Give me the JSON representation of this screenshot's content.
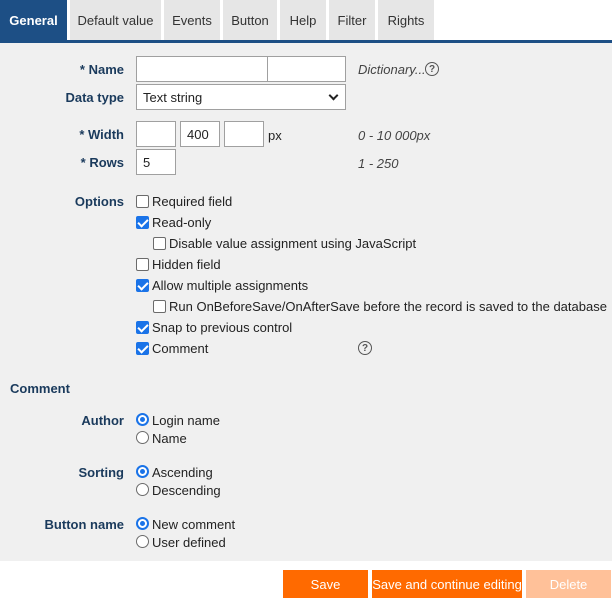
{
  "tabs": [
    {
      "label": "General"
    },
    {
      "label": "Default value"
    },
    {
      "label": "Events"
    },
    {
      "label": "Button"
    },
    {
      "label": "Help"
    },
    {
      "label": "Filter"
    },
    {
      "label": "Rights"
    }
  ],
  "form": {
    "name_label": "* Name",
    "name_value_1": "",
    "name_value_2": "",
    "dictionary_link": "Dictionary...",
    "help_glyph": "?",
    "data_type_label": "Data type",
    "data_type_value": "Text string",
    "width_label": "* Width",
    "width_min": "",
    "width_value": "400",
    "width_max": "",
    "width_unit": "px",
    "width_hint": "0 - 10 000px",
    "rows_label": "* Rows",
    "rows_value": "5",
    "rows_hint": "1 - 250",
    "options_label": "Options",
    "options": [
      {
        "label": "Required field",
        "checked": false
      },
      {
        "label": "Read-only",
        "checked": true
      },
      {
        "label": "Disable value assignment using JavaScript",
        "checked": false
      },
      {
        "label": "Hidden field",
        "checked": false
      },
      {
        "label": "Allow multiple assignments",
        "checked": true
      },
      {
        "label": "Run OnBeforeSave/OnAfterSave before the record is saved to the database",
        "checked": false
      },
      {
        "label": "Snap to previous control",
        "checked": true
      },
      {
        "label": "Comment",
        "checked": true
      }
    ]
  },
  "comment": {
    "section_title": "Comment",
    "author_label": "Author",
    "author_options": [
      {
        "label": "Login name",
        "selected": true
      },
      {
        "label": "Name",
        "selected": false
      }
    ],
    "sorting_label": "Sorting",
    "sorting_options": [
      {
        "label": "Ascending",
        "selected": true
      },
      {
        "label": "Descending",
        "selected": false
      }
    ],
    "button_name_label": "Button name",
    "button_name_options": [
      {
        "label": "New comment",
        "selected": true
      },
      {
        "label": "User defined",
        "selected": false
      }
    ]
  },
  "footer": {
    "save_label": "Save",
    "save_continue_label": "Save and continue editing",
    "delete_label": "Delete"
  },
  "colors": {
    "accent": "#1d4f85",
    "checkbox": "#1a73e8",
    "save": "#ff6a00",
    "delete_disabled": "#ffc199"
  }
}
